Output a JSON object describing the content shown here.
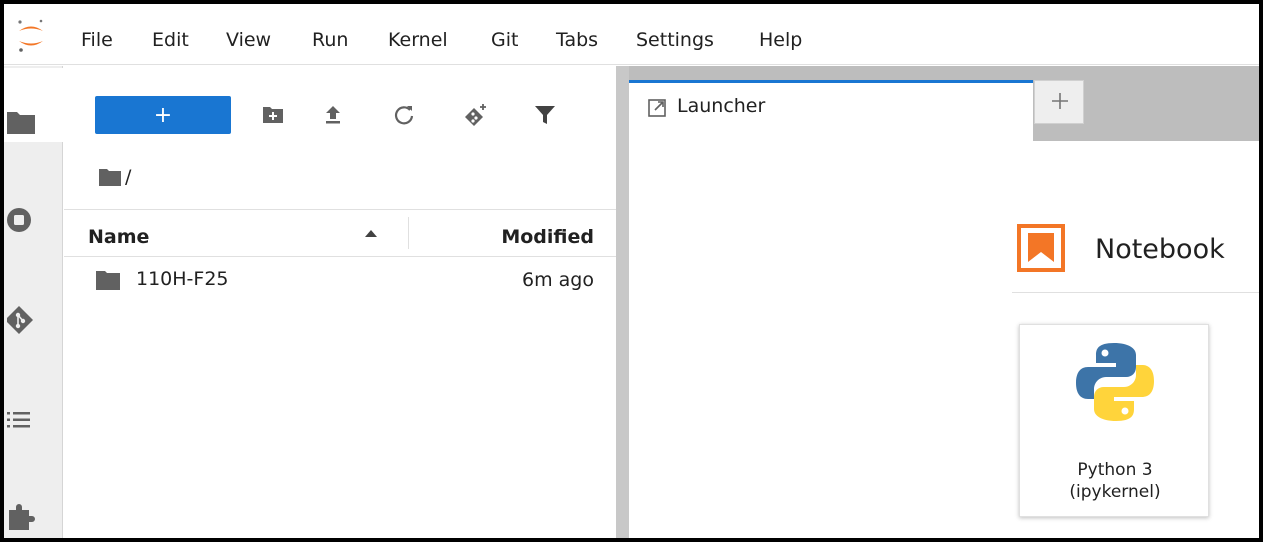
{
  "menu": {
    "items": [
      "File",
      "Edit",
      "View",
      "Run",
      "Kernel",
      "Git",
      "Tabs",
      "Settings",
      "Help"
    ]
  },
  "toolbar": {
    "new_label": "+"
  },
  "breadcrumb": {
    "path": "/"
  },
  "file_list": {
    "columns": {
      "name": "Name",
      "modified": "Modified"
    },
    "rows": [
      {
        "name": "110H-F25",
        "modified": "6m ago",
        "type": "folder"
      }
    ]
  },
  "tabs": [
    {
      "label": "Launcher",
      "icon": "launcher-icon",
      "active": true
    }
  ],
  "add_tab_icon": "plus-icon",
  "launcher": {
    "section_title": "Notebook",
    "kernels": [
      {
        "label": "Python 3\n(ipykernel)",
        "icon": "python-logo-icon"
      }
    ]
  },
  "colors": {
    "accent": "#1976d2",
    "notebook_orange": "#f37626",
    "python_blue": "#3d74a8",
    "python_yellow": "#ffd43b"
  }
}
